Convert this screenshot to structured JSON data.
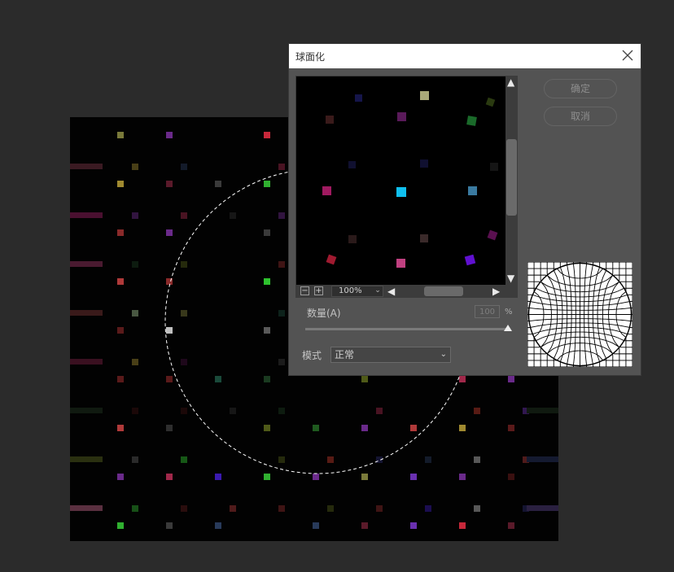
{
  "dialog": {
    "title": "球面化",
    "ok_label": "确定",
    "cancel_label": "取消",
    "zoom": "100%",
    "amount_label": "数量(A)",
    "amount_value": "100",
    "amount_unit": "%",
    "amount_percent": 100,
    "mode_label": "模式",
    "mode_value": "正常"
  },
  "icons": {
    "close": "close-icon",
    "zoom_out": "zoom-out-icon",
    "zoom_in": "zoom-in-icon",
    "scroll_up": "triangle-up-icon",
    "scroll_down": "triangle-down-icon",
    "scroll_left": "triangle-left-icon",
    "scroll_right": "triangle-right-icon",
    "dropdown": "chevron-down-icon"
  },
  "colors": {
    "workspace_bg": "#2b2b2b",
    "dialog_bg": "#535353",
    "canvas_bg": "#020202"
  }
}
